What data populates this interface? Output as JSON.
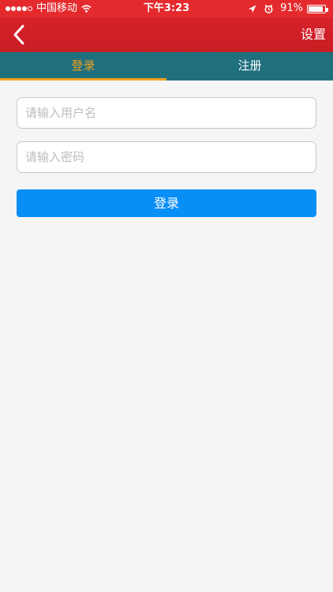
{
  "status_bar": {
    "carrier": "中国移动",
    "time": "下午3:23",
    "battery_percent": "91%",
    "battery_level": 0.91,
    "signal_strength": 4,
    "signal_max": 5,
    "icons": [
      "signal-dots",
      "wifi-icon",
      "location-arrow-icon",
      "alarm-clock-icon",
      "battery-icon"
    ]
  },
  "nav_bar": {
    "back_icon": "chevron-left-icon",
    "settings_label": "设置"
  },
  "tabs": [
    {
      "label": "登录",
      "active": true
    },
    {
      "label": "注册",
      "active": false
    }
  ],
  "form": {
    "username_placeholder": "请输入用户名",
    "password_placeholder": "请输入密码",
    "login_label": "登录"
  },
  "colors": {
    "status_bar": "#e42a2d",
    "nav_bar": "#d8212a",
    "tab_bar": "#1f6f7d",
    "active_tab": "#f0a11e",
    "login_button": "#088ef7",
    "page_background": "#f5f5f5"
  }
}
